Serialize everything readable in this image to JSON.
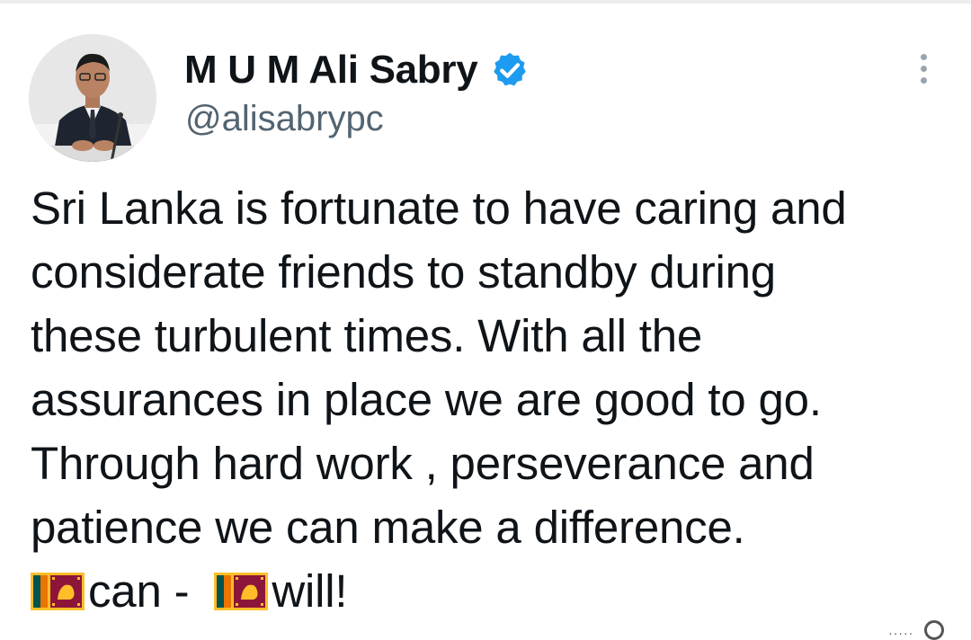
{
  "author": {
    "name": "M U M Ali Sabry",
    "handle": "@alisabrypc",
    "verified": true,
    "avatar_icon": "profile-photo-icon"
  },
  "tweet": {
    "lines": [
      "Sri Lanka is fortunate to have caring and",
      "considerate friends to standby during",
      "these turbulent times. With all the",
      "assurances in place we are good to go.",
      "Through hard work , perseverance and",
      "patience we can make a difference."
    ],
    "closing": {
      "part1": "can - ",
      "part2": "will!"
    }
  },
  "icons": {
    "verified": "verified-badge-icon",
    "more": "more-options-icon",
    "flag": "sri-lanka-flag-icon"
  },
  "colors": {
    "text": "#0f1419",
    "secondary": "#536471",
    "verified": "#1d9bf0"
  }
}
